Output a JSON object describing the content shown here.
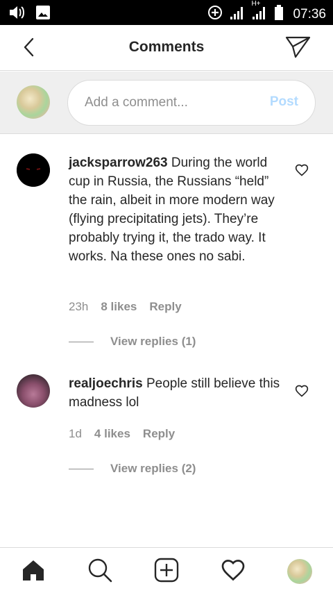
{
  "statusbar": {
    "time": "07:36",
    "icons": [
      "volume-icon",
      "image-icon",
      "data-saver-icon",
      "signal-icon",
      "signal-h-plus-icon",
      "battery-icon"
    ],
    "network_label": "H+"
  },
  "header": {
    "title": "Comments",
    "back_icon": "chevron-left-icon",
    "send_icon": "paper-plane-icon"
  },
  "composer": {
    "placeholder": "Add a comment...",
    "post_label": "Post",
    "post_color": "#b3dbff"
  },
  "comments": [
    {
      "username": "jacksparrow263",
      "text": "During the world cup in Russia, the Russians “held” the rain, albeit in more modern way (flying precipitating jets). They’re probably trying it, the trado way. It works. Na these ones no sabi.",
      "time": "23h",
      "likes": "8 likes",
      "reply_label": "Reply",
      "view_replies": "View replies (1)"
    },
    {
      "username": "realjoechris",
      "text": "People still believe this madness lol",
      "time": "1d",
      "likes": "4 likes",
      "reply_label": "Reply",
      "view_replies": "View replies (2)"
    }
  ],
  "bottomnav": {
    "items": [
      "home-icon",
      "search-icon",
      "add-post-icon",
      "activity-heart-icon",
      "profile-avatar"
    ]
  },
  "colors": {
    "text": "#262626",
    "secondary": "#8e8e8e",
    "divider": "#dbdbdb",
    "composer_bg": "#efefef"
  }
}
